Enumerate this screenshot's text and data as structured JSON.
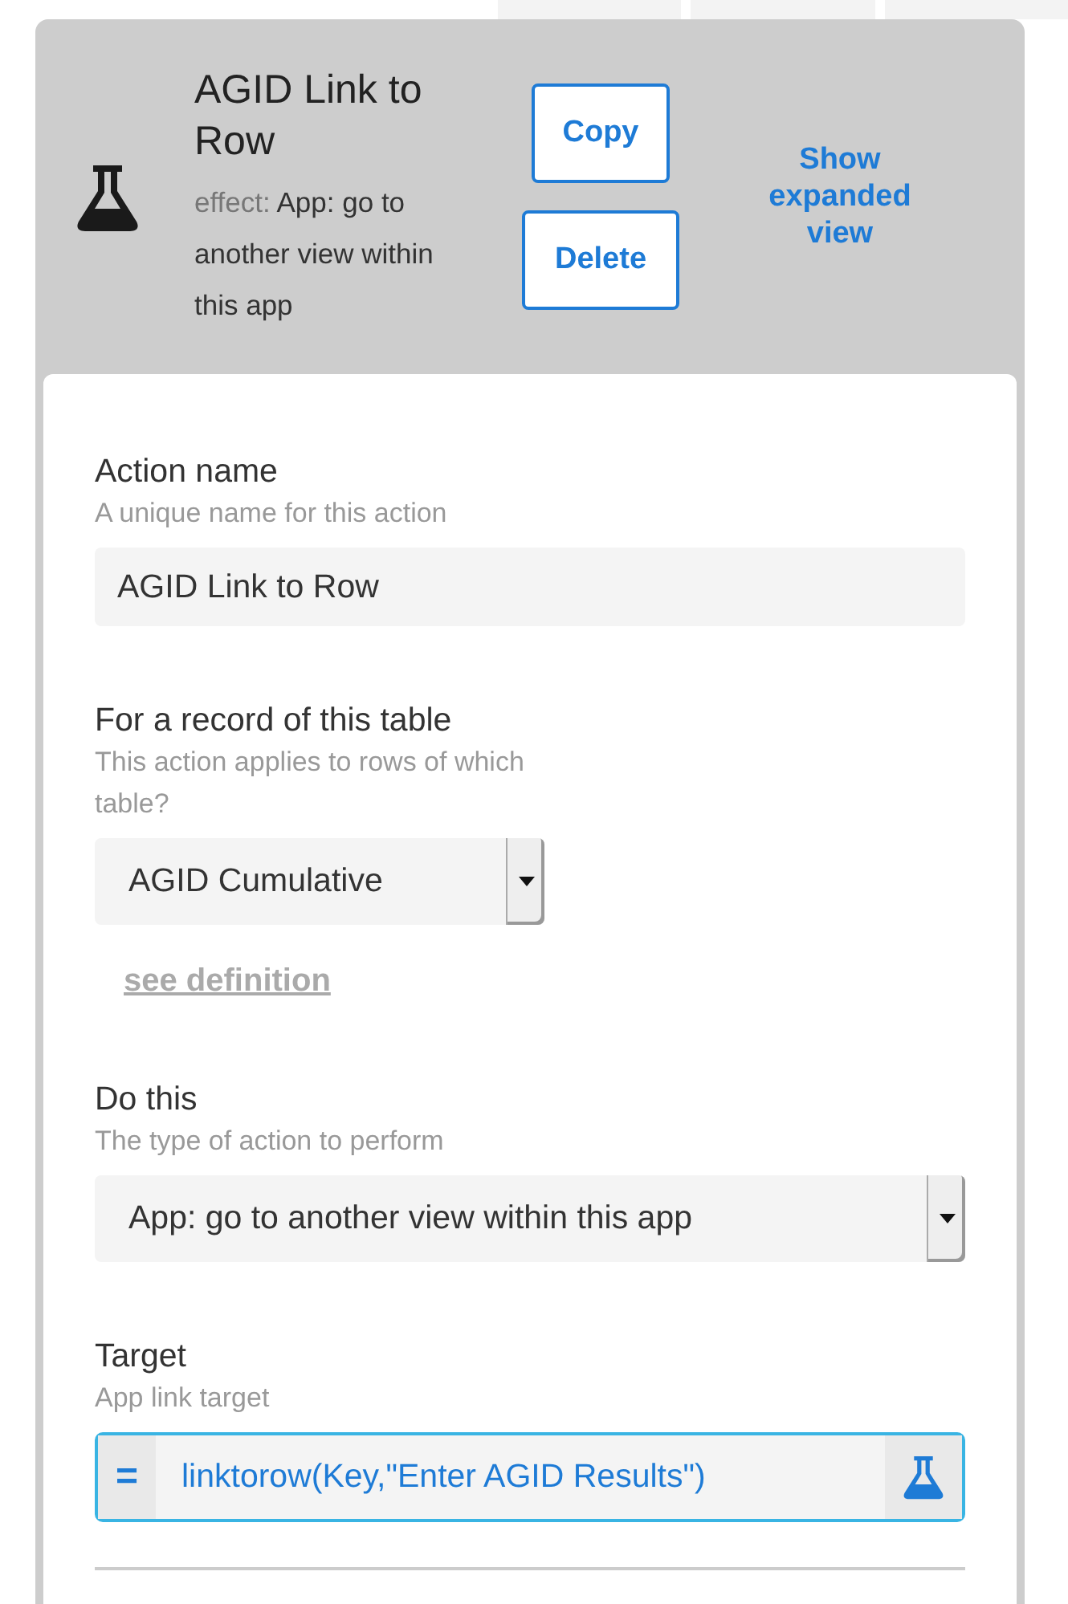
{
  "header": {
    "title": "AGID Link to Row",
    "effect_label": "effect:",
    "effect": "App: go to another view within this app",
    "buttons": [
      "Copy",
      "Delete"
    ],
    "expand_link": "Show expanded view"
  },
  "fields": [
    {
      "kind": "text",
      "label": "Action name",
      "hint": "A unique name for this action",
      "value": "AGID Link to Row"
    },
    {
      "kind": "select",
      "label": "For a record of this table",
      "hint": "This action applies to rows of which table?",
      "value": "AGID Cumulative",
      "link": "see definition"
    },
    {
      "kind": "select",
      "label": "Do this",
      "hint": "The type of action to perform",
      "value": "App: go to another view within this app"
    },
    {
      "kind": "formula",
      "label": "Target",
      "hint": "App link target",
      "prefix": "=",
      "value": "linktorow(Key,\"Enter AGID Results\")",
      "focused": true
    }
  ]
}
